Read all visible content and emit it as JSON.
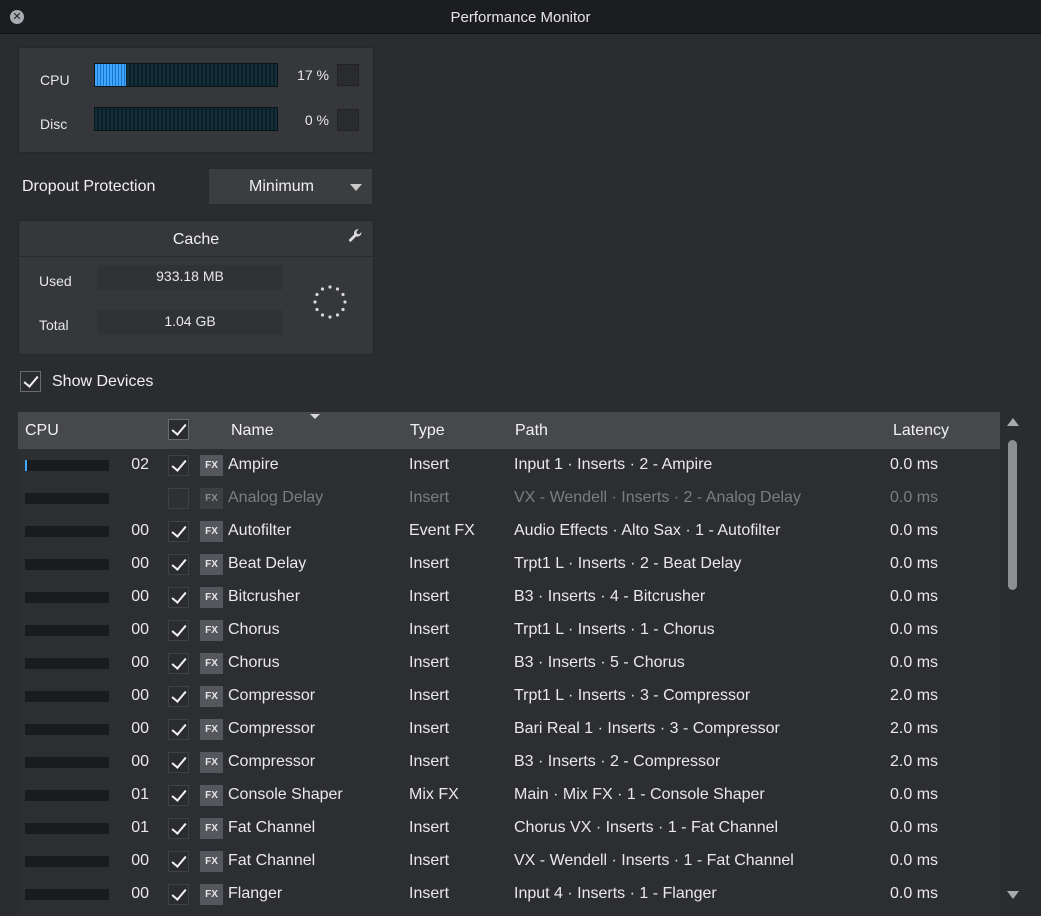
{
  "window": {
    "title": "Performance Monitor",
    "close_glyph": "✕"
  },
  "meters": {
    "cpu": {
      "label": "CPU",
      "value": "17 %",
      "level": 0.17
    },
    "disc": {
      "label": "Disc",
      "value": "0 %",
      "level": 0.0
    }
  },
  "dropout": {
    "label": "Dropout Protection",
    "value": "Minimum"
  },
  "cache": {
    "title": "Cache",
    "used_label": "Used",
    "used_value": "933.18 MB",
    "total_label": "Total",
    "total_value": "1.04 GB"
  },
  "show_devices": {
    "label": "Show Devices",
    "checked": true
  },
  "table": {
    "headers": {
      "cpu": "CPU",
      "name": "Name",
      "type": "Type",
      "path": "Path",
      "latency": "Latency"
    },
    "fx_badge": "FX",
    "rows": [
      {
        "cpu": "02",
        "cpu_level": 0.02,
        "enabled": true,
        "name": "Ampire",
        "type": "Insert",
        "path": "Input 1 · Inserts · 2 - Ampire",
        "latency": "0.0 ms"
      },
      {
        "cpu": "",
        "cpu_level": 0.0,
        "enabled": false,
        "name": "Analog Delay",
        "type": "Insert",
        "path": "VX - Wendell · Inserts · 2 - Analog Delay",
        "latency": "0.0 ms"
      },
      {
        "cpu": "00",
        "cpu_level": 0.0,
        "enabled": true,
        "name": "Autofilter",
        "type": "Event FX",
        "path": "Audio Effects · Alto Sax · 1 - Autofilter",
        "latency": "0.0 ms"
      },
      {
        "cpu": "00",
        "cpu_level": 0.0,
        "enabled": true,
        "name": "Beat Delay",
        "type": "Insert",
        "path": "Trpt1 L · Inserts · 2 - Beat Delay",
        "latency": "0.0 ms"
      },
      {
        "cpu": "00",
        "cpu_level": 0.0,
        "enabled": true,
        "name": "Bitcrusher",
        "type": "Insert",
        "path": "B3 · Inserts · 4 - Bitcrusher",
        "latency": "0.0 ms"
      },
      {
        "cpu": "00",
        "cpu_level": 0.0,
        "enabled": true,
        "name": "Chorus",
        "type": "Insert",
        "path": "Trpt1 L · Inserts · 1 - Chorus",
        "latency": "0.0 ms"
      },
      {
        "cpu": "00",
        "cpu_level": 0.0,
        "enabled": true,
        "name": "Chorus",
        "type": "Insert",
        "path": "B3 · Inserts · 5 - Chorus",
        "latency": "0.0 ms"
      },
      {
        "cpu": "00",
        "cpu_level": 0.0,
        "enabled": true,
        "name": "Compressor",
        "type": "Insert",
        "path": "Trpt1 L · Inserts · 3 - Compressor",
        "latency": "2.0 ms"
      },
      {
        "cpu": "00",
        "cpu_level": 0.0,
        "enabled": true,
        "name": "Compressor",
        "type": "Insert",
        "path": "Bari Real 1 · Inserts · 3 - Compressor",
        "latency": "2.0 ms"
      },
      {
        "cpu": "00",
        "cpu_level": 0.0,
        "enabled": true,
        "name": "Compressor",
        "type": "Insert",
        "path": "B3 · Inserts · 2 - Compressor",
        "latency": "2.0 ms"
      },
      {
        "cpu": "01",
        "cpu_level": 0.0,
        "enabled": true,
        "name": "Console Shaper",
        "type": "Mix FX",
        "path": "Main · Mix FX · 1 - Console Shaper",
        "latency": "0.0 ms"
      },
      {
        "cpu": "01",
        "cpu_level": 0.0,
        "enabled": true,
        "name": "Fat Channel",
        "type": "Insert",
        "path": "Chorus VX · Inserts · 1 - Fat Channel",
        "latency": "0.0 ms"
      },
      {
        "cpu": "00",
        "cpu_level": 0.0,
        "enabled": true,
        "name": "Fat Channel",
        "type": "Insert",
        "path": "VX - Wendell · Inserts · 1 - Fat Channel",
        "latency": "0.0 ms"
      },
      {
        "cpu": "00",
        "cpu_level": 0.0,
        "enabled": true,
        "name": "Flanger",
        "type": "Insert",
        "path": "Input 4 · Inserts · 1 - Flanger",
        "latency": "0.0 ms"
      }
    ]
  }
}
